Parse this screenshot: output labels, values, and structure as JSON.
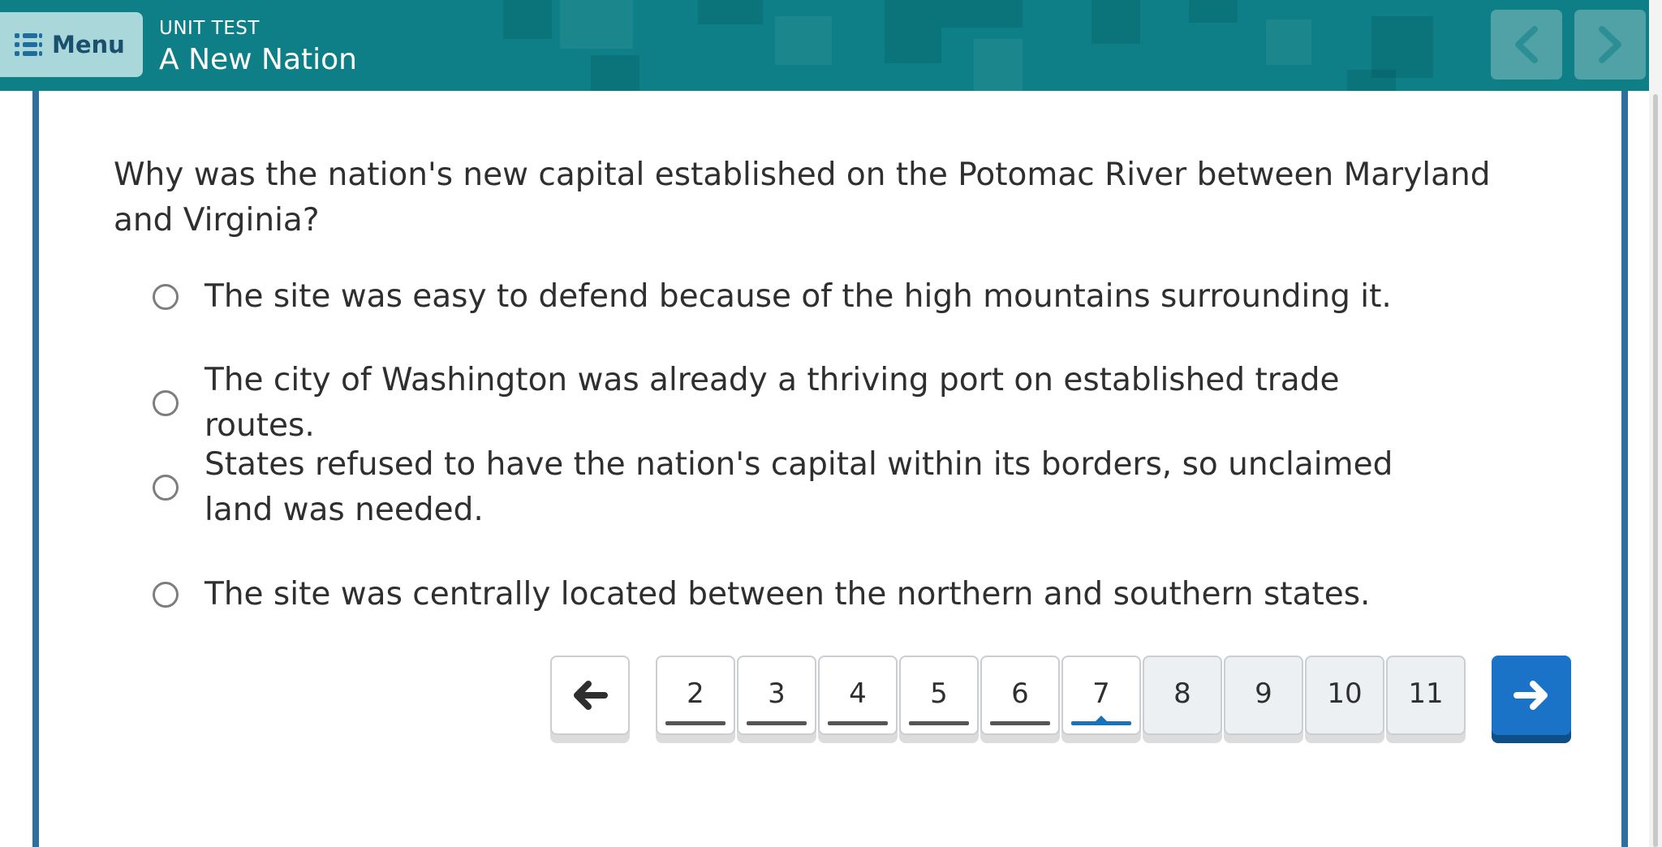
{
  "header": {
    "menu_label": "Menu",
    "kicker": "UNIT TEST",
    "title": "A New Nation",
    "icons": {
      "menu": "list-menu-icon",
      "prev": "chevron-left-icon",
      "next": "chevron-right-icon"
    }
  },
  "question": {
    "text": "Why was the nation's new capital established on the Potomac River between Maryland and Virginia?",
    "options": [
      {
        "text": "The site was easy to defend because of the high mountains surrounding it.",
        "selected": false
      },
      {
        "text": "The city of Washington was already a thriving port on established trade routes.",
        "selected": false
      },
      {
        "text": "States refused to have the nation's capital within its borders, so unclaimed land was needed.",
        "selected": false
      },
      {
        "text": "The site was centrally located between the northern and southern states.",
        "selected": false
      }
    ]
  },
  "pager": {
    "prev_icon": "arrow-left-icon",
    "next_icon": "arrow-right-icon",
    "current": "7",
    "pages": [
      {
        "label": "2",
        "visited": true
      },
      {
        "label": "3",
        "visited": true
      },
      {
        "label": "4",
        "visited": true
      },
      {
        "label": "5",
        "visited": true
      },
      {
        "label": "6",
        "visited": true
      },
      {
        "label": "7",
        "visited": true
      },
      {
        "label": "8",
        "visited": false
      },
      {
        "label": "9",
        "visited": false
      },
      {
        "label": "10",
        "visited": false
      },
      {
        "label": "11",
        "visited": false
      }
    ]
  },
  "colors": {
    "header_bg": "#0e7f86",
    "frame": "#2f6f9e",
    "accent": "#1a73c6",
    "text": "#2f2f2f"
  }
}
